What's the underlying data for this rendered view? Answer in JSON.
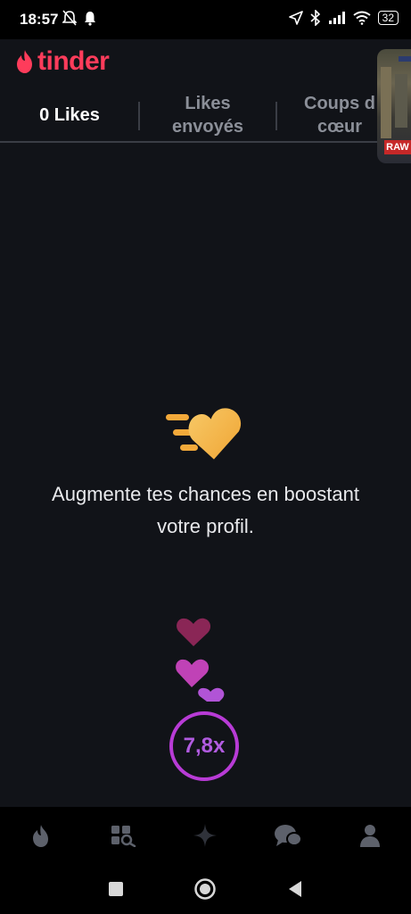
{
  "status_bar": {
    "time": "18:57",
    "battery": "32",
    "icons": [
      "muted-bell-icon",
      "notification-bell-icon",
      "location-icon",
      "bluetooth-icon",
      "signal-icon",
      "wifi-icon",
      "battery-icon"
    ]
  },
  "header": {
    "logo_text": "tinder",
    "brand_color": "#fe3c5b"
  },
  "tabs": [
    {
      "label": "0 Likes",
      "active": true
    },
    {
      "label": "Likes\nenvoyés",
      "active": false
    },
    {
      "label": "Coups d\ncœur",
      "active": false
    }
  ],
  "pip": {
    "badge": "RAW"
  },
  "main": {
    "message": "Augmente tes chances en boostant votre profil.",
    "boost_multiplier": "7,8x",
    "accent_color": "#f5b746",
    "boost_color": "#b15be0"
  },
  "bottom_nav": {
    "items": [
      "flame-icon",
      "explore-icon",
      "sparkle-icon",
      "chat-icon",
      "profile-icon"
    ]
  },
  "system_nav": {
    "items": [
      "recent-apps-icon",
      "home-icon",
      "back-icon"
    ]
  }
}
